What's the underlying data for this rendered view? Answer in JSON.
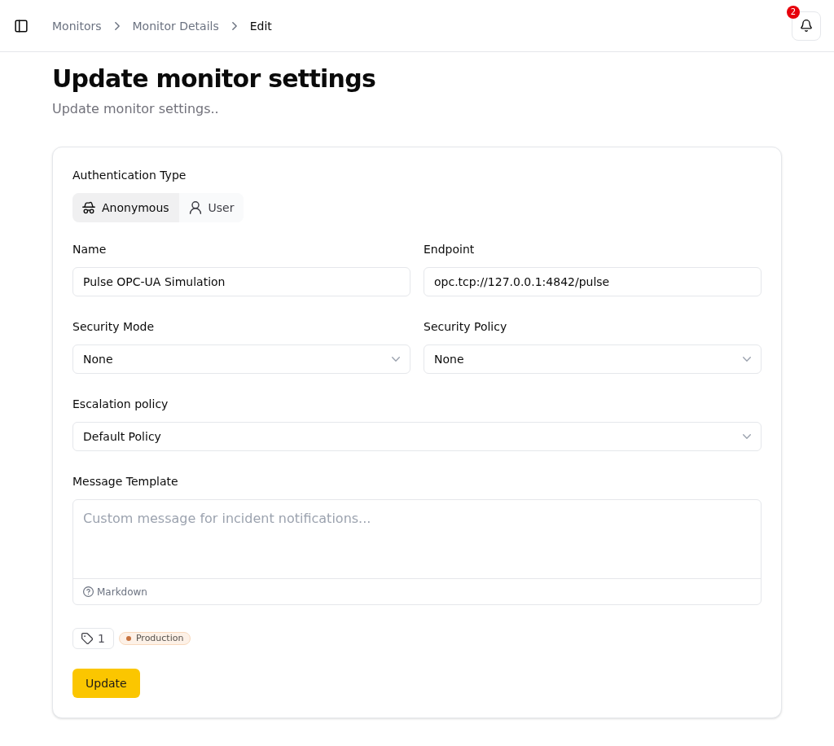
{
  "header": {
    "breadcrumbs": [
      {
        "label": "Monitors",
        "current": false
      },
      {
        "label": "Monitor Details",
        "current": false
      },
      {
        "label": "Edit",
        "current": true
      }
    ],
    "notifications": {
      "count": "2"
    }
  },
  "page": {
    "title": "Update monitor settings",
    "subtitle": "Update monitor settings.."
  },
  "form": {
    "auth_type": {
      "label": "Authentication Type",
      "options": [
        {
          "kind": "anonymous",
          "label": "Anonymous",
          "selected": true
        },
        {
          "kind": "user",
          "label": "User",
          "selected": false
        }
      ]
    },
    "rows": [
      [
        {
          "kind": "text",
          "label": "Name",
          "value": "Pulse OPC-UA Simulation"
        },
        {
          "kind": "text",
          "label": "Endpoint",
          "value": "opc.tcp://127.0.0.1:4842/pulse"
        }
      ],
      [
        {
          "kind": "select",
          "label": "Security Mode",
          "value": "None"
        },
        {
          "kind": "select",
          "label": "Security Policy",
          "value": "None"
        }
      ],
      [
        {
          "kind": "select",
          "label": "Escalation policy",
          "value": "Default Policy"
        }
      ]
    ],
    "message_template": {
      "label": "Message Template",
      "placeholder": "Custom message for incident notifications...",
      "help": "Markdown"
    },
    "tags": {
      "count": "1",
      "items": [
        {
          "label": "Production",
          "color": "#c8733f"
        }
      ]
    },
    "submit": "Update"
  }
}
